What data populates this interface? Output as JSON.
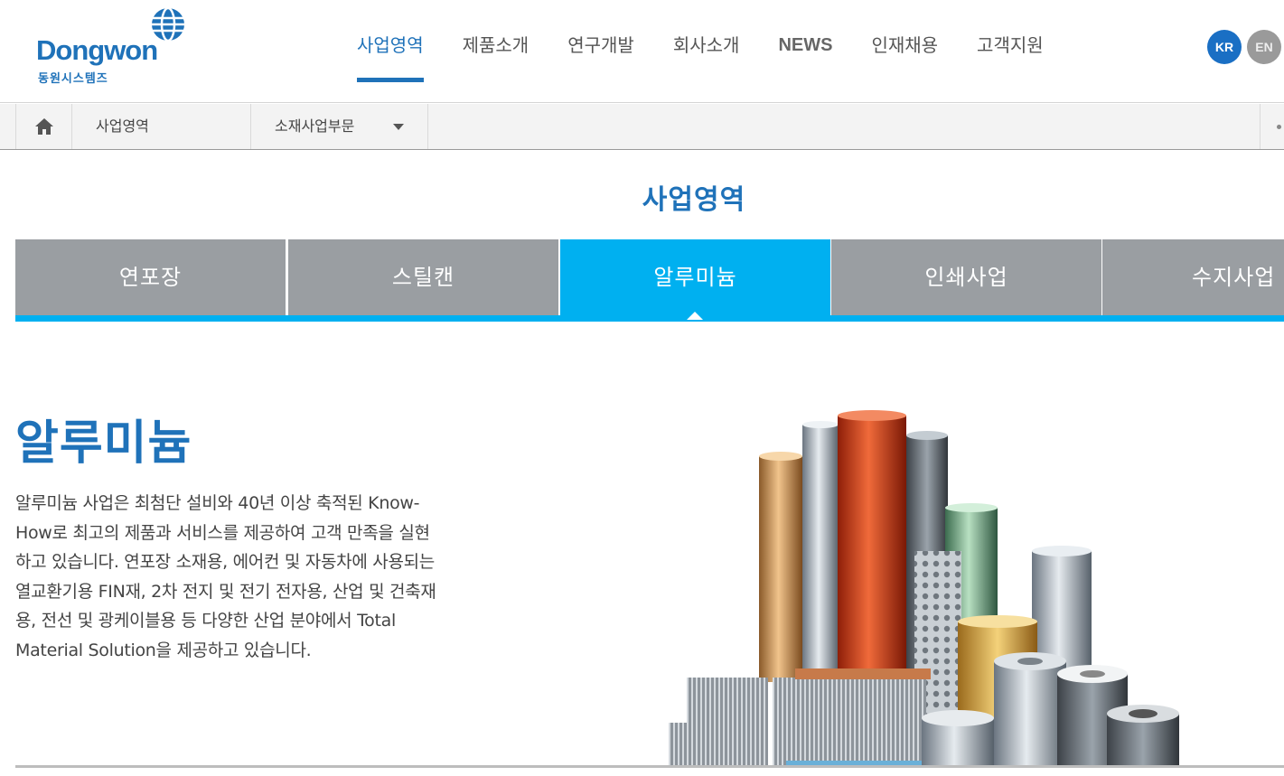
{
  "header": {
    "logo_text": "Dongwon",
    "logo_sub": "동원시스템즈",
    "nav": [
      {
        "label": "사업영역",
        "active": true
      },
      {
        "label": "제품소개"
      },
      {
        "label": "연구개발"
      },
      {
        "label": "회사소개"
      },
      {
        "label": "NEWS"
      },
      {
        "label": "인재채용"
      },
      {
        "label": "고객지원"
      }
    ],
    "lang_kr": "KR",
    "lang_en": "EN"
  },
  "breadcrumb": {
    "home_icon": "home-icon",
    "level1": "사업영역",
    "level2": "소재사업부문"
  },
  "section_title": "사업영역",
  "tabs": [
    {
      "label": "연포장"
    },
    {
      "label": "스틸캔"
    },
    {
      "label": "알루미늄",
      "active": true
    },
    {
      "label": "인쇄사업"
    },
    {
      "label": "수지사업"
    }
  ],
  "content": {
    "title": "알루미늄",
    "description": "알루미늄 사업은 최첨단 설비와 40년 이상 축적된 Know-How로 최고의 제품과 서비스를 제공하여 고객 만족을 실현하고 있습니다. 연포장 소재용, 에어컨 및 자동차에 사용되는 열교환기용 FIN재, 2차 전지 및 전기 전자용, 산업 및 건축재용, 전선 및 광케이블용 등 다양한 산업 분야에서 Total Material Solution을 제공하고 있습니다."
  },
  "colors": {
    "brand_blue": "#1f72b9",
    "tab_active": "#00b0f0",
    "tab_inactive": "#9a9ea2"
  }
}
